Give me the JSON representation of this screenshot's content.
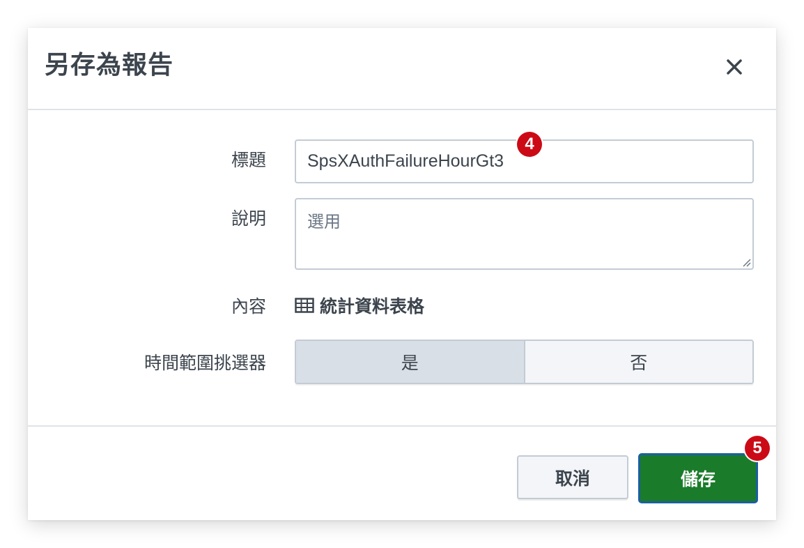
{
  "dialog": {
    "title": "另存為報告",
    "close_icon": "close-icon"
  },
  "form": {
    "title_label": "標題",
    "title_value": "SpsXAuthFailureHourGt3",
    "description_label": "說明",
    "description_placeholder": "選用",
    "content_label": "內容",
    "content_icon": "table-icon",
    "content_value": "統計資料表格",
    "time_picker_label": "時間範圍挑選器",
    "time_picker_options": [
      "是",
      "否"
    ],
    "time_picker_selected": "是"
  },
  "footer": {
    "cancel_label": "取消",
    "save_label": "儲存"
  },
  "annotations": {
    "badge_title": "4",
    "badge_save": "5"
  },
  "colors": {
    "save_button": "#1a7c2a",
    "save_button_focus": "#1b5fa1",
    "badge": "#cc0a16",
    "selected_toggle": "#d9dfe6"
  }
}
